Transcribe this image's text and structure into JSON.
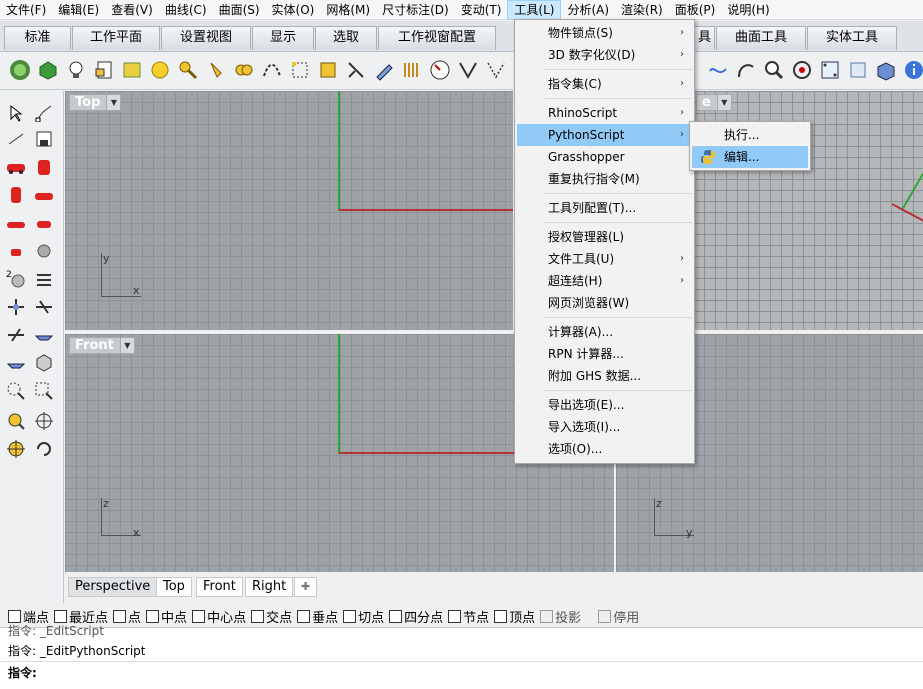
{
  "menubar": [
    "文件(F)",
    "编辑(E)",
    "查看(V)",
    "曲线(C)",
    "曲面(S)",
    "实体(O)",
    "网格(M)",
    "尺寸标注(D)",
    "变动(T)",
    "工具(L)",
    "分析(A)",
    "渲染(R)",
    "面板(P)",
    "说明(H)"
  ],
  "tabs": [
    "标准",
    "工作平面",
    "设置视图",
    "显示",
    "选取",
    "工作视窗配置",
    "具",
    "曲面工具",
    "实体工具"
  ],
  "viewports": {
    "top_label": "Top",
    "perspective_label_partial": "e",
    "front_label": "Front",
    "x": "x",
    "y": "y",
    "z": "z"
  },
  "view_tabs": [
    "Perspective",
    "Top",
    "Front",
    "Right"
  ],
  "view_tab_add": "✚",
  "osnap": [
    "端点",
    "最近点",
    "点",
    "中点",
    "中心点",
    "交点",
    "垂点",
    "切点",
    "四分点",
    "节点",
    "顶点",
    "投影",
    "停用"
  ],
  "command": {
    "history1": "指令: _EditScript",
    "history2": "指令: _EditPythonScript",
    "prompt": "指令:"
  },
  "tools_menu": {
    "items": [
      {
        "label": "物件锁点(S)",
        "submenu": true
      },
      {
        "label": "3D 数字化仪(D)",
        "submenu": true
      },
      {
        "label": "指令集(C)",
        "submenu": true
      },
      {
        "label": "RhinoScript",
        "submenu": true
      },
      {
        "label": "PythonScript",
        "submenu": true
      },
      {
        "label": "Grasshopper",
        "submenu": false
      },
      {
        "label": "重复执行指令(M)",
        "submenu": false
      },
      {
        "label": "工具列配置(T)...",
        "submenu": false
      },
      {
        "label": "授权管理器(L)",
        "submenu": false
      },
      {
        "label": "文件工具(U)",
        "submenu": true
      },
      {
        "label": "超连结(H)",
        "submenu": true
      },
      {
        "label": "网页浏览器(W)",
        "submenu": false
      },
      {
        "label": "计算器(A)...",
        "submenu": false
      },
      {
        "label": "RPN 计算器...",
        "submenu": false
      },
      {
        "label": "附加 GHS 数据...",
        "submenu": false
      },
      {
        "label": "导出选项(E)...",
        "submenu": false
      },
      {
        "label": "导入选项(I)...",
        "submenu": false
      },
      {
        "label": "选项(O)...",
        "submenu": false
      }
    ],
    "arrow": "›"
  },
  "python_submenu": [
    "执行...",
    "编辑..."
  ],
  "colors": {
    "highlight": "#91c9f7",
    "x_axis": "#b73232",
    "y_axis": "#2fa52f",
    "viewport_bg": "#9ea3a8"
  }
}
